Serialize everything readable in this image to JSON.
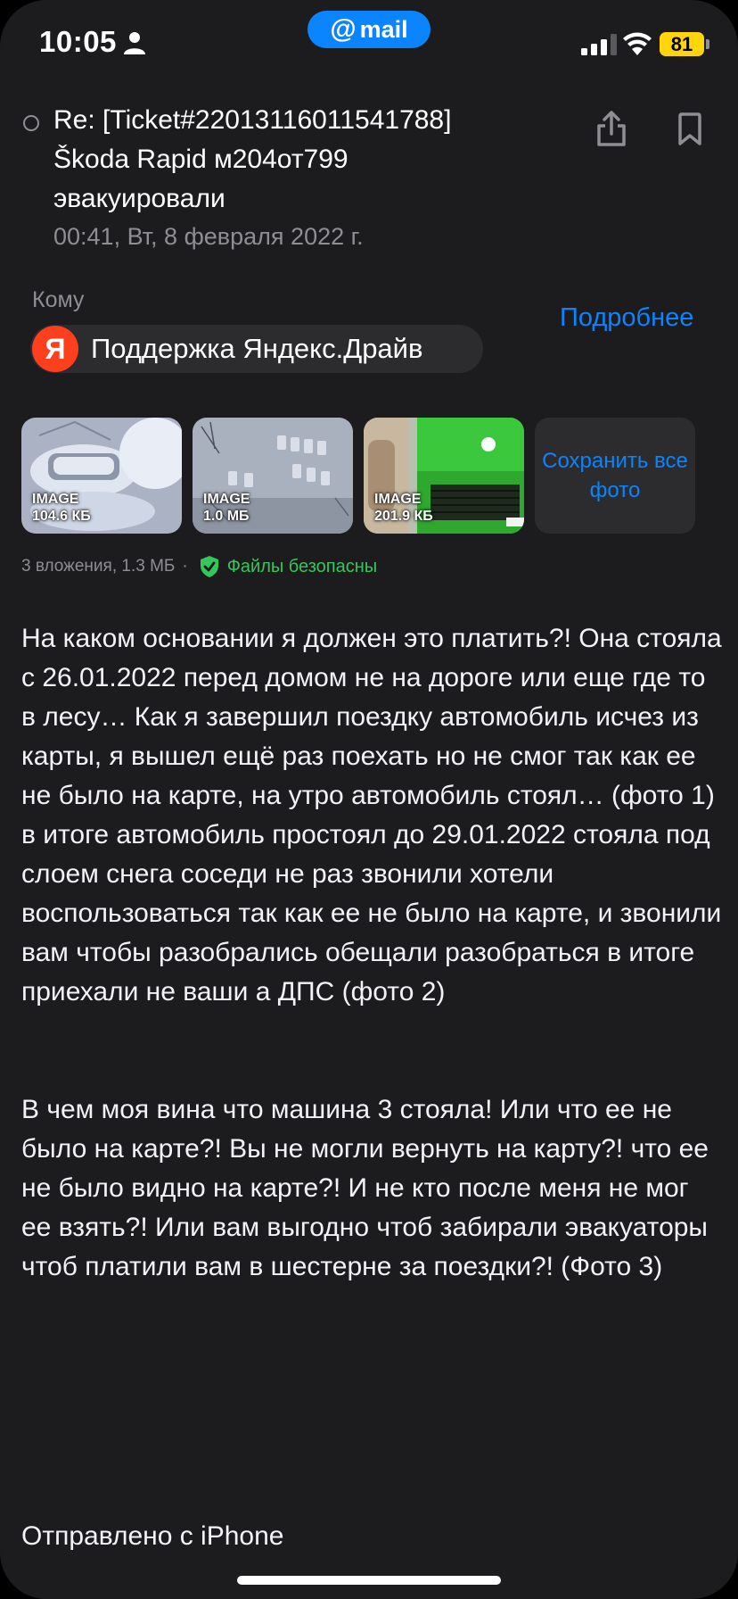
{
  "status_bar": {
    "time": "10:05",
    "app_badge": "mail",
    "battery": "81",
    "icons": [
      "person-icon",
      "signal-icon",
      "wifi-icon",
      "battery-icon"
    ]
  },
  "email": {
    "subject": "Re: [Ticket#22013116011541788] Škoda Rapid м204от799 эвакуировали",
    "date": "00:41, Вт, 8 февраля 2022 г.",
    "to_label": "Кому",
    "more_label": "Подробнее",
    "recipient": {
      "logo_letter": "Я",
      "name": "Поддержка Яндекс.Драйв"
    },
    "attachments": [
      {
        "type": "IMAGE",
        "size": "104.6 КБ"
      },
      {
        "type": "IMAGE",
        "size": "1.0 МБ"
      },
      {
        "type": "IMAGE",
        "size": "201.9 КБ"
      }
    ],
    "save_all_label": "Сохранить все фото",
    "attachments_summary": "3 вложения, 1.3 МБ",
    "separator": "·",
    "safe_label": "Файлы безопасны",
    "body": "На каком основании я должен это платить?! Она стояла с 26.01.2022 перед домом не на дороге или еще где то в лесу… Как я завершил поездку автомобиль исчез из карты, я вышел ещё раз поехать но не смог так как ее не было на карте, на утро автомобиль стоял… (фото 1)\nв итоге автомобиль простоял до 29.01.2022 стояла под слоем снега соседи не раз звонили хотели воспользоваться так как ее не было на карте, и звонили вам чтобы разобрались обещали разобраться в итоге приехали не ваши а ДПС (фото 2)\n\n\nВ чем моя вина что машина 3 стояла! Или что ее не было на карте?! Вы не могли вернуть на карту?! что ее не было видно на карте?! И не кто после меня не мог ее взять?! Или вам выгодно чтоб забирали эвакуаторы чтоб платили вам в шестерне за поездки?! (Фото 3)",
    "signature": "Отправлено с iPhone"
  },
  "colors": {
    "background": "#1c1c1e",
    "accent": "#0a84ff",
    "safe": "#34c759",
    "battery": "#ffd60a",
    "yandex": "#fc3f1d"
  }
}
